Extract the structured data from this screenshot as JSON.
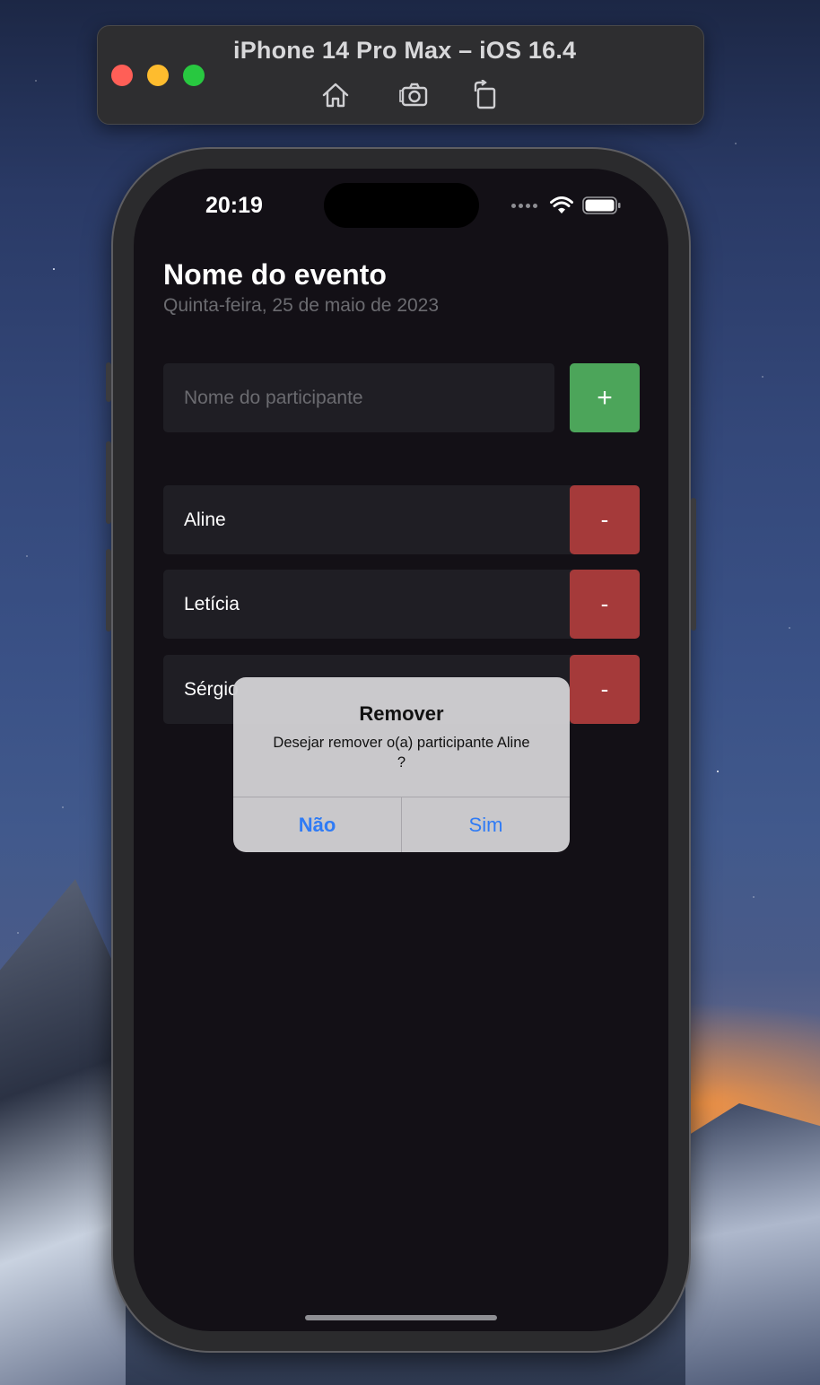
{
  "simulator": {
    "title": "iPhone 14 Pro Max – iOS 16.4",
    "toolbar_icons": [
      "home-icon",
      "screenshot-icon",
      "rotate-icon"
    ]
  },
  "status_bar": {
    "time": "20:19"
  },
  "event": {
    "title": "Nome do evento",
    "date": "Quinta-feira, 25 de maio de 2023"
  },
  "form": {
    "placeholder": "Nome do participante",
    "add_label": "+"
  },
  "participants": [
    {
      "name": "Aline",
      "remove_label": "-"
    },
    {
      "name": "Letícia",
      "remove_label": "-"
    },
    {
      "name": "Sérgio",
      "remove_label": "-"
    }
  ],
  "alert": {
    "title": "Remover",
    "message": "Desejar remover o(a) participante Aline ?",
    "cancel_label": "Não",
    "confirm_label": "Sim"
  },
  "colors": {
    "add_button": "#4ca55a",
    "remove_button": "#a53a3a",
    "alert_action": "#2f7bf5",
    "background": "#131016"
  }
}
